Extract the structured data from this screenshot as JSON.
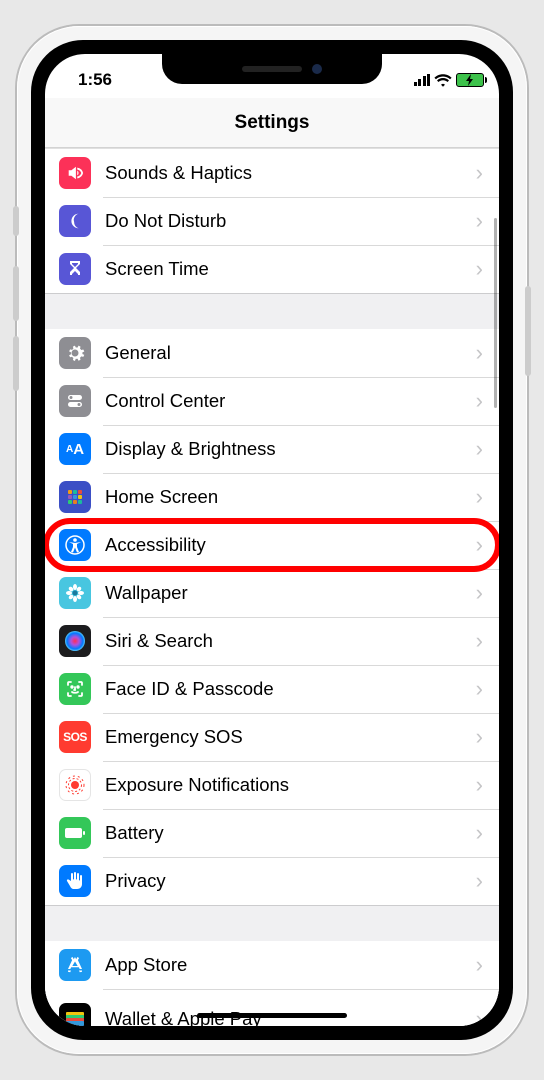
{
  "status": {
    "time": "1:56"
  },
  "header": {
    "title": "Settings"
  },
  "groups": [
    {
      "items": [
        {
          "id": "sounds",
          "label": "Sounds & Haptics"
        },
        {
          "id": "dnd",
          "label": "Do Not Disturb"
        },
        {
          "id": "screentime",
          "label": "Screen Time"
        }
      ]
    },
    {
      "items": [
        {
          "id": "general",
          "label": "General"
        },
        {
          "id": "controlcenter",
          "label": "Control Center"
        },
        {
          "id": "display",
          "label": "Display & Brightness"
        },
        {
          "id": "homescreen",
          "label": "Home Screen"
        },
        {
          "id": "accessibility",
          "label": "Accessibility",
          "highlighted": true
        },
        {
          "id": "wallpaper",
          "label": "Wallpaper"
        },
        {
          "id": "siri",
          "label": "Siri & Search"
        },
        {
          "id": "faceid",
          "label": "Face ID & Passcode"
        },
        {
          "id": "sos",
          "label": "Emergency SOS"
        },
        {
          "id": "exposure",
          "label": "Exposure Notifications"
        },
        {
          "id": "battery",
          "label": "Battery"
        },
        {
          "id": "privacy",
          "label": "Privacy"
        }
      ]
    },
    {
      "items": [
        {
          "id": "appstore",
          "label": "App Store"
        },
        {
          "id": "wallet",
          "label": "Wallet & Apple Pay"
        }
      ]
    }
  ],
  "sos_text": "SOS"
}
